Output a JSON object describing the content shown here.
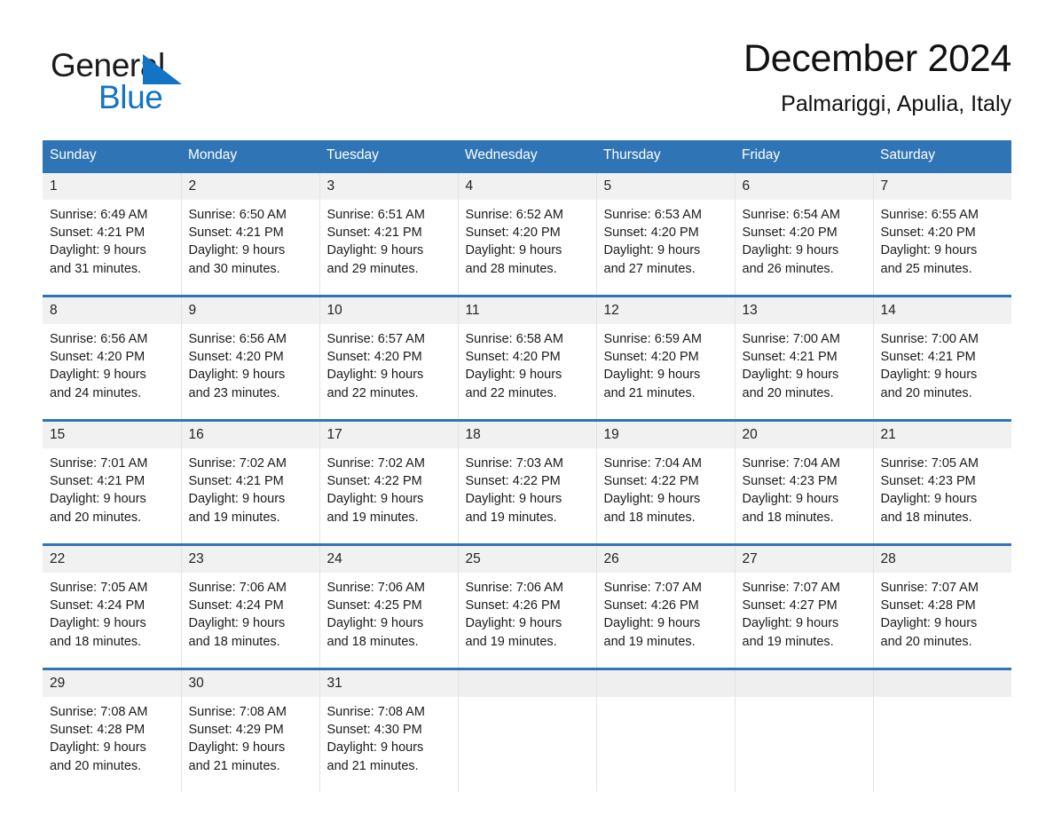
{
  "brand": {
    "name_part1": "General",
    "name_part2": "Blue",
    "logo_icon": "sail-triangle-icon",
    "accent_color": "#1373c4"
  },
  "header": {
    "title": "December 2024",
    "subtitle": "Palmariggi, Apulia, Italy"
  },
  "theme": {
    "header_blue": "#2f75b5",
    "daynum_band": "#f1f1f1",
    "empty_band": "#efefef",
    "text": "#1a1a1a"
  },
  "weekday_headers": [
    "Sunday",
    "Monday",
    "Tuesday",
    "Wednesday",
    "Thursday",
    "Friday",
    "Saturday"
  ],
  "weeks": [
    [
      {
        "day": "1",
        "lines": [
          "Sunrise: 6:49 AM",
          "Sunset: 4:21 PM",
          "Daylight: 9 hours",
          "and 31 minutes."
        ]
      },
      {
        "day": "2",
        "lines": [
          "Sunrise: 6:50 AM",
          "Sunset: 4:21 PM",
          "Daylight: 9 hours",
          "and 30 minutes."
        ]
      },
      {
        "day": "3",
        "lines": [
          "Sunrise: 6:51 AM",
          "Sunset: 4:21 PM",
          "Daylight: 9 hours",
          "and 29 minutes."
        ]
      },
      {
        "day": "4",
        "lines": [
          "Sunrise: 6:52 AM",
          "Sunset: 4:20 PM",
          "Daylight: 9 hours",
          "and 28 minutes."
        ]
      },
      {
        "day": "5",
        "lines": [
          "Sunrise: 6:53 AM",
          "Sunset: 4:20 PM",
          "Daylight: 9 hours",
          "and 27 minutes."
        ]
      },
      {
        "day": "6",
        "lines": [
          "Sunrise: 6:54 AM",
          "Sunset: 4:20 PM",
          "Daylight: 9 hours",
          "and 26 minutes."
        ]
      },
      {
        "day": "7",
        "lines": [
          "Sunrise: 6:55 AM",
          "Sunset: 4:20 PM",
          "Daylight: 9 hours",
          "and 25 minutes."
        ]
      }
    ],
    [
      {
        "day": "8",
        "lines": [
          "Sunrise: 6:56 AM",
          "Sunset: 4:20 PM",
          "Daylight: 9 hours",
          "and 24 minutes."
        ]
      },
      {
        "day": "9",
        "lines": [
          "Sunrise: 6:56 AM",
          "Sunset: 4:20 PM",
          "Daylight: 9 hours",
          "and 23 minutes."
        ]
      },
      {
        "day": "10",
        "lines": [
          "Sunrise: 6:57 AM",
          "Sunset: 4:20 PM",
          "Daylight: 9 hours",
          "and 22 minutes."
        ]
      },
      {
        "day": "11",
        "lines": [
          "Sunrise: 6:58 AM",
          "Sunset: 4:20 PM",
          "Daylight: 9 hours",
          "and 22 minutes."
        ]
      },
      {
        "day": "12",
        "lines": [
          "Sunrise: 6:59 AM",
          "Sunset: 4:20 PM",
          "Daylight: 9 hours",
          "and 21 minutes."
        ]
      },
      {
        "day": "13",
        "lines": [
          "Sunrise: 7:00 AM",
          "Sunset: 4:21 PM",
          "Daylight: 9 hours",
          "and 20 minutes."
        ]
      },
      {
        "day": "14",
        "lines": [
          "Sunrise: 7:00 AM",
          "Sunset: 4:21 PM",
          "Daylight: 9 hours",
          "and 20 minutes."
        ]
      }
    ],
    [
      {
        "day": "15",
        "lines": [
          "Sunrise: 7:01 AM",
          "Sunset: 4:21 PM",
          "Daylight: 9 hours",
          "and 20 minutes."
        ]
      },
      {
        "day": "16",
        "lines": [
          "Sunrise: 7:02 AM",
          "Sunset: 4:21 PM",
          "Daylight: 9 hours",
          "and 19 minutes."
        ]
      },
      {
        "day": "17",
        "lines": [
          "Sunrise: 7:02 AM",
          "Sunset: 4:22 PM",
          "Daylight: 9 hours",
          "and 19 minutes."
        ]
      },
      {
        "day": "18",
        "lines": [
          "Sunrise: 7:03 AM",
          "Sunset: 4:22 PM",
          "Daylight: 9 hours",
          "and 19 minutes."
        ]
      },
      {
        "day": "19",
        "lines": [
          "Sunrise: 7:04 AM",
          "Sunset: 4:22 PM",
          "Daylight: 9 hours",
          "and 18 minutes."
        ]
      },
      {
        "day": "20",
        "lines": [
          "Sunrise: 7:04 AM",
          "Sunset: 4:23 PM",
          "Daylight: 9 hours",
          "and 18 minutes."
        ]
      },
      {
        "day": "21",
        "lines": [
          "Sunrise: 7:05 AM",
          "Sunset: 4:23 PM",
          "Daylight: 9 hours",
          "and 18 minutes."
        ]
      }
    ],
    [
      {
        "day": "22",
        "lines": [
          "Sunrise: 7:05 AM",
          "Sunset: 4:24 PM",
          "Daylight: 9 hours",
          "and 18 minutes."
        ]
      },
      {
        "day": "23",
        "lines": [
          "Sunrise: 7:06 AM",
          "Sunset: 4:24 PM",
          "Daylight: 9 hours",
          "and 18 minutes."
        ]
      },
      {
        "day": "24",
        "lines": [
          "Sunrise: 7:06 AM",
          "Sunset: 4:25 PM",
          "Daylight: 9 hours",
          "and 18 minutes."
        ]
      },
      {
        "day": "25",
        "lines": [
          "Sunrise: 7:06 AM",
          "Sunset: 4:26 PM",
          "Daylight: 9 hours",
          "and 19 minutes."
        ]
      },
      {
        "day": "26",
        "lines": [
          "Sunrise: 7:07 AM",
          "Sunset: 4:26 PM",
          "Daylight: 9 hours",
          "and 19 minutes."
        ]
      },
      {
        "day": "27",
        "lines": [
          "Sunrise: 7:07 AM",
          "Sunset: 4:27 PM",
          "Daylight: 9 hours",
          "and 19 minutes."
        ]
      },
      {
        "day": "28",
        "lines": [
          "Sunrise: 7:07 AM",
          "Sunset: 4:28 PM",
          "Daylight: 9 hours",
          "and 20 minutes."
        ]
      }
    ],
    [
      {
        "day": "29",
        "lines": [
          "Sunrise: 7:08 AM",
          "Sunset: 4:28 PM",
          "Daylight: 9 hours",
          "and 20 minutes."
        ]
      },
      {
        "day": "30",
        "lines": [
          "Sunrise: 7:08 AM",
          "Sunset: 4:29 PM",
          "Daylight: 9 hours",
          "and 21 minutes."
        ]
      },
      {
        "day": "31",
        "lines": [
          "Sunrise: 7:08 AM",
          "Sunset: 4:30 PM",
          "Daylight: 9 hours",
          "and 21 minutes."
        ]
      },
      {
        "day": "",
        "lines": []
      },
      {
        "day": "",
        "lines": []
      },
      {
        "day": "",
        "lines": []
      },
      {
        "day": "",
        "lines": []
      }
    ]
  ]
}
